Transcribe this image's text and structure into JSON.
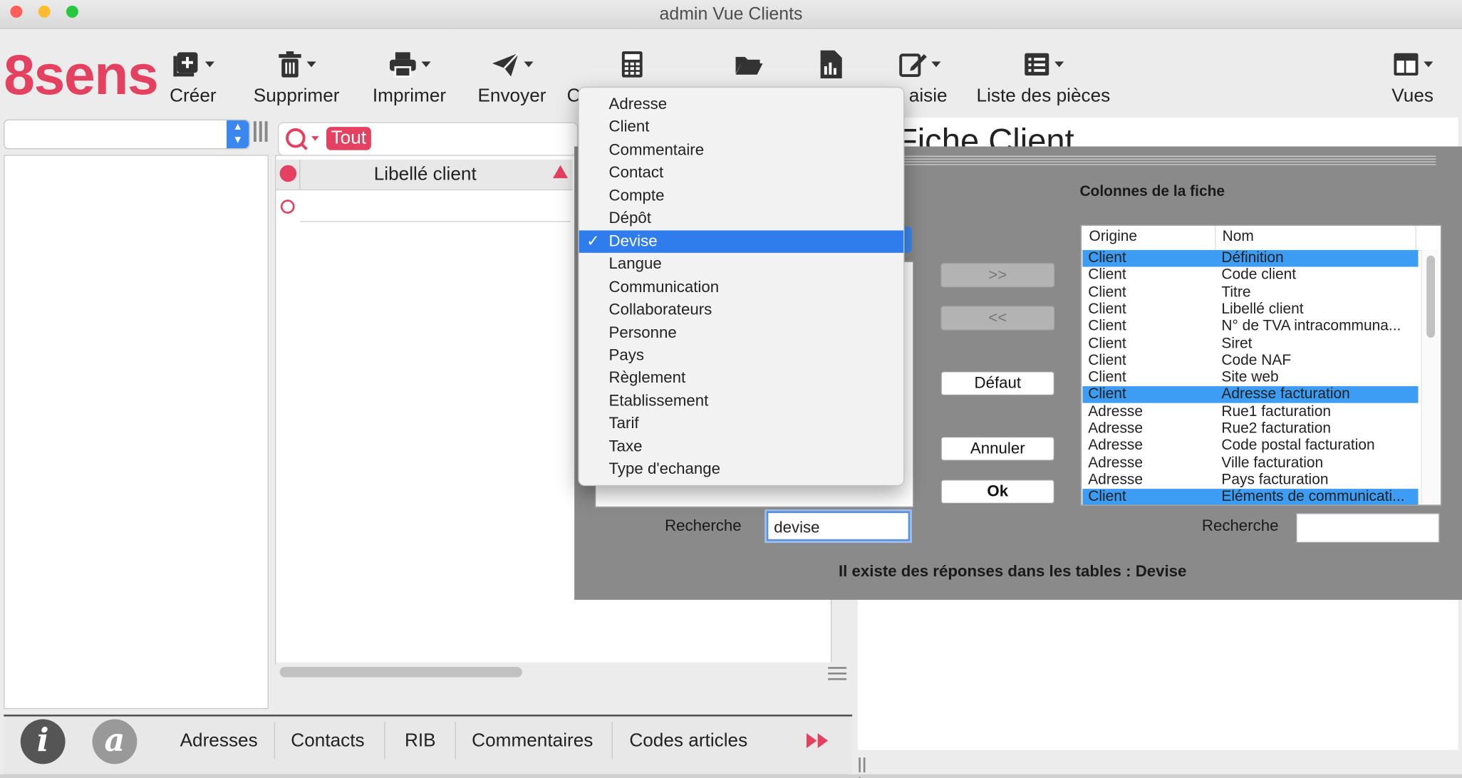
{
  "window": {
    "title": "admin Vue Clients"
  },
  "logo": "8sens",
  "toolbar": {
    "creer": "Créer",
    "supprimer": "Supprimer",
    "imprimer": "Imprimer",
    "envoyer": "Envoyer",
    "calc_partial": "C",
    "saisie_partial": "aisie",
    "liste": "Liste des pièces",
    "vues": "Vues"
  },
  "search": {
    "filter_chip": "Tout"
  },
  "list": {
    "header": "Libellé client"
  },
  "background": {
    "fiche_title": "Fiche Client"
  },
  "dialog": {
    "columns_title": "Colonnes de la fiche",
    "btn_add": ">>",
    "btn_remove": "<<",
    "btn_default": "Défaut",
    "btn_cancel": "Annuler",
    "btn_ok": "Ok",
    "search_label_left": "Recherche",
    "search_value_left": "devise",
    "search_label_right": "Recherche",
    "search_value_right": "",
    "status": "Il existe des réponses dans les tables : Devise",
    "right_headers": {
      "origine": "Origine",
      "nom": "Nom"
    },
    "right_rows": [
      {
        "origine": "Client",
        "nom": "Définition",
        "selected": true
      },
      {
        "origine": "Client",
        "nom": "Code client",
        "selected": false
      },
      {
        "origine": "Client",
        "nom": "Titre",
        "selected": false
      },
      {
        "origine": "Client",
        "nom": "Libellé client",
        "selected": false
      },
      {
        "origine": "Client",
        "nom": "N° de TVA intracommuna...",
        "selected": false
      },
      {
        "origine": "Client",
        "nom": "Siret",
        "selected": false
      },
      {
        "origine": "Client",
        "nom": "Code NAF",
        "selected": false
      },
      {
        "origine": "Client",
        "nom": "Site web",
        "selected": false
      },
      {
        "origine": "Client",
        "nom": "Adresse facturation",
        "selected": true
      },
      {
        "origine": "Adresse",
        "nom": "Rue1 facturation",
        "selected": false
      },
      {
        "origine": "Adresse",
        "nom": "Rue2 facturation",
        "selected": false
      },
      {
        "origine": "Adresse",
        "nom": "Code postal facturation",
        "selected": false
      },
      {
        "origine": "Adresse",
        "nom": "Ville facturation",
        "selected": false
      },
      {
        "origine": "Adresse",
        "nom": "Pays facturation",
        "selected": false
      },
      {
        "origine": "Client",
        "nom": "Eléments de communicati...",
        "selected": true
      }
    ]
  },
  "menu": {
    "checkmark": "✓",
    "items": [
      {
        "label": "Adresse",
        "selected": false
      },
      {
        "label": "Client",
        "selected": false
      },
      {
        "label": "Commentaire",
        "selected": false
      },
      {
        "label": "Contact",
        "selected": false
      },
      {
        "label": "Compte",
        "selected": false
      },
      {
        "label": "Dépôt",
        "selected": false
      },
      {
        "label": "Devise",
        "selected": true
      },
      {
        "label": "Langue",
        "selected": false
      },
      {
        "label": "Communication",
        "selected": false
      },
      {
        "label": "Collaborateurs",
        "selected": false
      },
      {
        "label": "Personne",
        "selected": false
      },
      {
        "label": "Pays",
        "selected": false
      },
      {
        "label": "Règlement",
        "selected": false
      },
      {
        "label": "Etablissement",
        "selected": false
      },
      {
        "label": "Tarif",
        "selected": false
      },
      {
        "label": "Taxe",
        "selected": false
      },
      {
        "label": "Type d'echange",
        "selected": false
      }
    ]
  },
  "bottom_tabs": {
    "info_icon": "i",
    "at_icon": "a",
    "adresses": "Adresses",
    "contacts": "Contacts",
    "rib": "RIB",
    "commentaires": "Commentaires",
    "codes_articles": "Codes articles"
  },
  "colors": {
    "accent": "#e4405f",
    "selection": "#3d9cf3",
    "menu_selection": "#2f7ded",
    "dialog_bg": "#8a8a8a"
  }
}
